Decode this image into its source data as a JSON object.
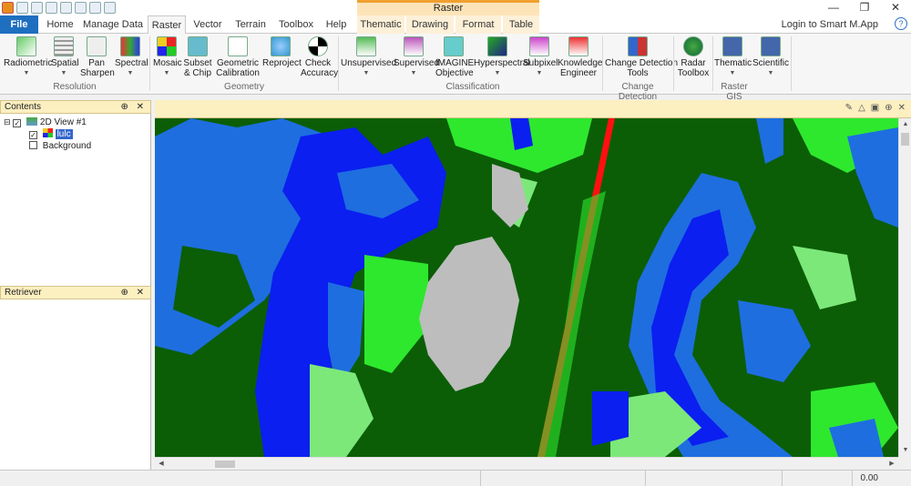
{
  "window": {
    "context_header": "Raster",
    "controls": [
      "—",
      "❐",
      "✕"
    ]
  },
  "tabs": {
    "file": "File",
    "home": "Home",
    "manage_data": "Manage Data",
    "raster": "Raster",
    "vector": "Vector",
    "terrain": "Terrain",
    "toolbox": "Toolbox",
    "help": "Help",
    "thematic": "Thematic",
    "drawing": "Drawing",
    "format": "Format",
    "table": "Table",
    "login": "Login to Smart M.App",
    "help_icon": "?"
  },
  "ribbon": {
    "radiometric": "Radiometric",
    "spatial": "Spatial",
    "pan_sharpen_1": "Pan",
    "pan_sharpen_2": "Sharpen",
    "spectral": "Spectral",
    "mosaic": "Mosaic",
    "subset_1": "Subset",
    "subset_2": "& Chip",
    "geo_cal_1": "Geometric",
    "geo_cal_2": "Calibration",
    "reproject": "Reproject",
    "check_acc_1": "Check",
    "check_acc_2": "Accuracy",
    "unsupervised": "Unsupervised",
    "supervised": "Supervised",
    "imagine_1": "IMAGINE",
    "imagine_2": "Objective",
    "hyperspectral": "Hyperspectral",
    "subpixel": "Subpixel",
    "knowledge_1": "Knowledge",
    "knowledge_2": "Engineer",
    "change_det_1": "Change Detection",
    "change_det_2": "Tools",
    "radar_1": "Radar",
    "radar_2": "Toolbox",
    "thematic": "Thematic",
    "scientific": "Scientific",
    "groups": {
      "resolution": "Resolution",
      "geometry": "Geometry",
      "classification": "Classification",
      "change_detection": "Change Detection",
      "raster_gis": "Raster GIS"
    }
  },
  "contents_panel": {
    "title": "Contents",
    "view_name": "2D View #1",
    "layer_name": "lulc",
    "background": "Background"
  },
  "retriever_panel": {
    "title": "Retriever"
  },
  "panel_controls": "⊕ ✕",
  "status": {
    "value": "0.00"
  },
  "map_colors": {
    "forest": "#0b5e06",
    "water_deep": "#0b1ff0",
    "water_light": "#1e6ee0",
    "grass": "#2ee82e",
    "lightgreen": "#7ce87a",
    "urban": "#bdbdbd",
    "road": "#ff1010"
  }
}
